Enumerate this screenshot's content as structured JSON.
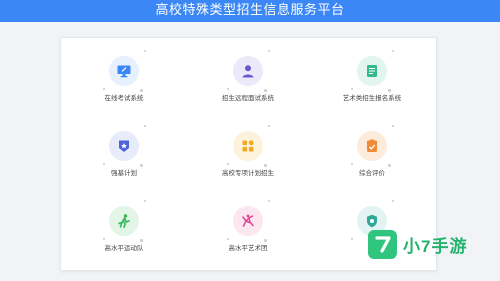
{
  "header": {
    "title": "高校特殊类型招生信息服务平台"
  },
  "tiles": [
    {
      "label": "在线考试系统",
      "icon": "monitor-icon",
      "bg": "#e6f0ff",
      "color": "#3b87f5"
    },
    {
      "label": "招生远程面试系统",
      "icon": "person-icon",
      "bg": "#ece9fb",
      "color": "#6a5acd"
    },
    {
      "label": "艺术类招生报名系统",
      "icon": "document-icon",
      "bg": "#e2f5ee",
      "color": "#35b98a"
    },
    {
      "label": "强基计划",
      "icon": "badge-icon",
      "bg": "#e8ebfa",
      "color": "#4f63d8"
    },
    {
      "label": "高校专项计划招生",
      "icon": "grid-icon",
      "bg": "#fdf2dc",
      "color": "#f3a81f"
    },
    {
      "label": "综合评价",
      "icon": "clipboard-icon",
      "bg": "#fdebdc",
      "color": "#f08a34"
    },
    {
      "label": "高水平运动队",
      "icon": "runner-icon",
      "bg": "#e2f5e6",
      "color": "#35b657"
    },
    {
      "label": "高水平艺术团",
      "icon": "dancer-icon",
      "bg": "#fce6f0",
      "color": "#e0468f"
    },
    {
      "label": "保",
      "icon": "shield-icon",
      "bg": "#e2f4f1",
      "color": "#2fa896"
    }
  ],
  "watermark": {
    "text": "小7手游",
    "logo": "7"
  }
}
